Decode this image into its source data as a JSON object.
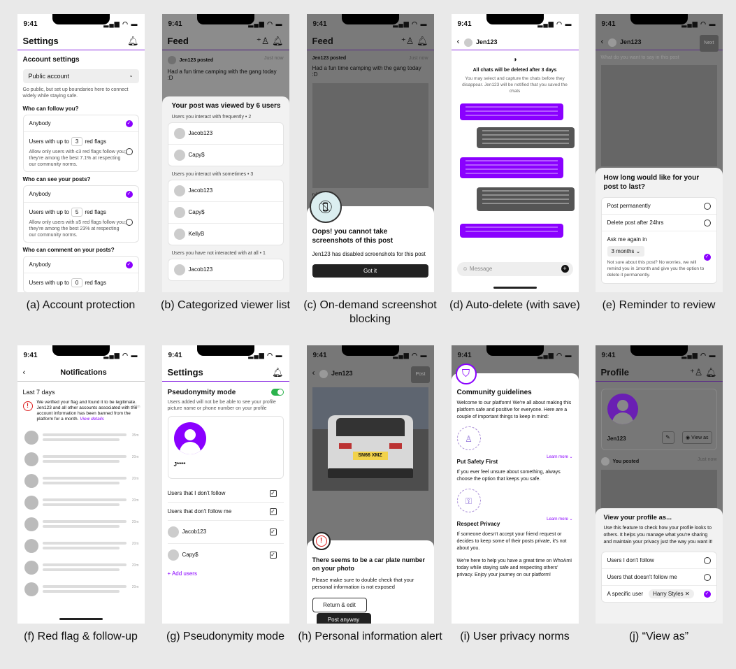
{
  "status_time": "9:41",
  "status_icons": "▂▄▆ ◠ ▬",
  "panels": {
    "a": {
      "caption": "(a) Account protection",
      "title": "Settings",
      "section": "Account settings",
      "dropdown": "Public account",
      "hint": "Go public, but set up boundaries here to connect widely while staying safe.",
      "q1": "Who can follow you?",
      "anybody": "Anybody",
      "users_up_to": "Users with up to",
      "red_flags": "red flags",
      "n1": "3",
      "d1": "Allow only users with ≤3 red flags follow you; they're among the best 7.1% at respecting our community norms.",
      "q2": "Who can see your posts?",
      "n2": "5",
      "d2": "Allow only users with ≤5 red flags follow you; they're among the best 23% at respecting our community norms.",
      "q3": "Who can comment on your posts?",
      "n3": "0"
    },
    "b": {
      "caption": "(b) Categorized viewer list",
      "title": "Feed",
      "poster": "Jen123 posted",
      "ago": "Just now",
      "post_text": "Had a fun time camping with the gang today :D",
      "sheet_title": "Your post was viewed by 6 users",
      "g1": "Users you interact with frequently • 2",
      "g1_users": [
        "Jacob123",
        "Capy$"
      ],
      "g2": "Users you interact with sometimes • 3",
      "g2_users": [
        "Jacob123",
        "Capy$",
        "KellyB"
      ],
      "g3": "Users you have not interacted with at all • 1",
      "g3_users": [
        "Jacob123"
      ]
    },
    "c": {
      "caption": "(c) On-demand screenshot blocking",
      "title": "Feed",
      "poster": "Jen123 posted",
      "ago": "Just now",
      "post_text": "Had a fun time camping with the gang today :D",
      "alert_title": "Oops! you cannot take screenshots of this post",
      "alert_body": "Jen123 has disabled screenshots for this post",
      "button": "Got it"
    },
    "d": {
      "caption": "(d) Auto-delete (with save)",
      "user": "Jen123",
      "notice_title": "All chats will be deleted after 3 days",
      "notice_body": "You may select and capture the chats before they disappear. Jen123 will be notified that you saved the chats",
      "placeholder": "Message"
    },
    "e": {
      "caption": "(e) Reminder to review",
      "user": "Jen123",
      "next": "Next",
      "prompt": "What do you want to say in this post",
      "sheet_title": "How long would like for your post to last?",
      "opt1": "Post permanently",
      "opt2": "Delete post after 24hrs",
      "opt3": "Ask me again in",
      "duration": "3 months",
      "note": "Not sure about this post? No worries, we will remind you in 1month and give you the option to delete it permanently."
    },
    "f": {
      "caption": "(f) Red flag & follow-up",
      "title": "Notifications",
      "section": "Last 7 days",
      "msg": "We verified your flag and found it to be legitimate. Jen123 and all other accounts associated with the account information has been banned from the platform for a month.",
      "link": "View details",
      "time": "30m",
      "times": [
        "35m",
        "20m",
        "20m",
        "20m",
        "20m",
        "20m",
        "20m",
        "20m"
      ]
    },
    "g": {
      "caption": "(g) Pseudonymity mode",
      "title": "Settings",
      "mode": "Pseudonymity mode",
      "desc": "Users added will not be be able to see your profile picture name or phone number on your profile",
      "masked": "J****",
      "items": [
        "Users that I don't follow",
        "Users that don't follow me",
        "Jacob123",
        "Capy$"
      ],
      "add": "Add users"
    },
    "h": {
      "caption": "(h) Personal information alert",
      "user": "Jen123",
      "post": "Post",
      "plate": "SN66 XMZ",
      "alert_title": "There seems to be a car plate number on your photo",
      "alert_body": "Please make sure to double check that your personal information is not exposed",
      "btn1": "Return & edit",
      "btn2": "Post anyway"
    },
    "i": {
      "caption": "(i) User privacy norms",
      "title": "Community guidelines",
      "intro": "Welcome to our platform! We're all about making this platform safe and positive for everyone. Here are a couple of important things to keep in mind:",
      "h1": "Put Safety First",
      "p1": "If you ever feel unsure about something, always choose the option that keeps you safe.",
      "h2": "Respect Privacy",
      "p2": "If someone doesn't accept your friend request or decides to keep some of their posts private, it's not about you.",
      "outro": "We're here to help you have a great time on WhoAmI today while staying safe and respecting others' privacy. Enjoy your journey on our platform!",
      "learn": "Learn more"
    },
    "j": {
      "caption": "(j) “View as”",
      "title": "Profile",
      "user": "Jen123",
      "view_as": "View as",
      "poster": "You posted",
      "ago": "Just now",
      "sheet_title": "View your profile as...",
      "desc": "Use this feature to check how your profile looks to others. It helps you manage what you're sharing and maintain your privacy just the way you want it!",
      "opt1": "Users I don't follow",
      "opt2": "Users that doesn't follow me",
      "opt3": "A specific user",
      "chip": "Harry Styles"
    }
  }
}
